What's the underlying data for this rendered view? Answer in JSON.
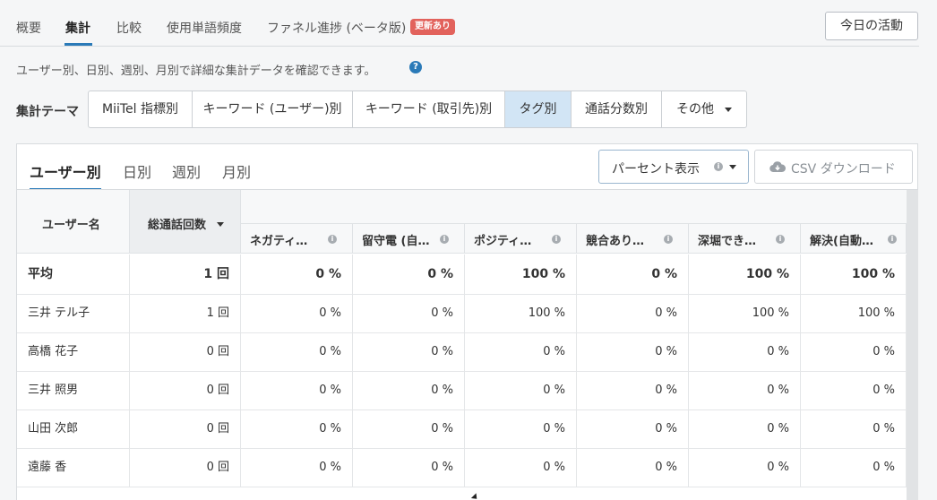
{
  "nav": {
    "tabs": [
      {
        "label": "概要"
      },
      {
        "label": "集計"
      },
      {
        "label": "比較"
      },
      {
        "label": "使用単語頻度"
      },
      {
        "label": "ファネル進捗 (ベータ版)"
      }
    ],
    "active_tab": "集計",
    "beta_badge": "更新あり",
    "today_button": "今日の活動"
  },
  "description": "ユーザー別、日別、週別、月別で詳細な集計データを確認できます。",
  "help_icon": "?",
  "theme": {
    "label": "集計テーマ",
    "options": [
      "MiiTel 指標別",
      "キーワード (ユーザー)別",
      "キーワード (取引先)別",
      "タグ別",
      "通話分数別",
      "その他"
    ],
    "selected": "タグ別"
  },
  "panel": {
    "subtabs": [
      "ユーザー別",
      "日別",
      "週別",
      "月別"
    ],
    "active_subtab": "ユーザー別",
    "percent_select": "パーセント表示",
    "csv_button": "CSV ダウンロード",
    "info_glyph": "i"
  },
  "table": {
    "header_user": "ユーザー名",
    "header_total": "総通話回数",
    "columns": [
      "ネガティ…",
      "留守電 (自…",
      "ポジティ…",
      "競合あり…",
      "深堀でき…",
      "解決(自動…"
    ],
    "average": {
      "name": "平均",
      "total": "1 回",
      "values": [
        "0 %",
        "0 %",
        "100 %",
        "0 %",
        "100 %",
        "100 %"
      ]
    },
    "rows": [
      {
        "name": "三井 テル子",
        "total": "1 回",
        "values": [
          "0 %",
          "0 %",
          "100 %",
          "0 %",
          "100 %",
          "100 %"
        ]
      },
      {
        "name": "高橋 花子",
        "total": "0 回",
        "values": [
          "0 %",
          "0 %",
          "0 %",
          "0 %",
          "0 %",
          "0 %"
        ]
      },
      {
        "name": "三井 照男",
        "total": "0 回",
        "values": [
          "0 %",
          "0 %",
          "0 %",
          "0 %",
          "0 %",
          "0 %"
        ]
      },
      {
        "name": "山田 次郎",
        "total": "0 回",
        "values": [
          "0 %",
          "0 %",
          "0 %",
          "0 %",
          "0 %",
          "0 %"
        ]
      },
      {
        "name": "遠藤 香",
        "total": "0 回",
        "values": [
          "0 %",
          "0 %",
          "0 %",
          "0 %",
          "0 %",
          "0 %"
        ]
      }
    ]
  },
  "colors": {
    "accent": "#2a7ab8",
    "badge": "#e2625c",
    "selected_segment": "#d2e5f5"
  }
}
